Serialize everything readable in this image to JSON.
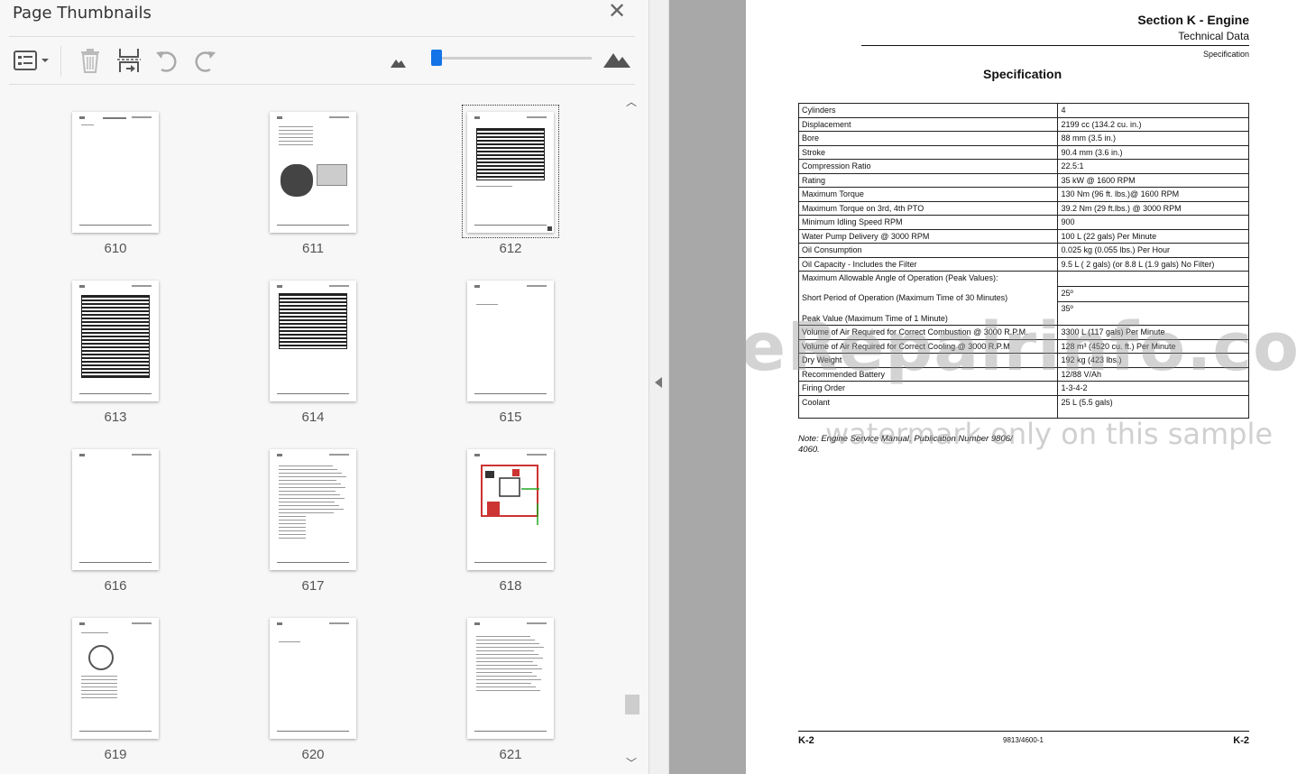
{
  "panel": {
    "title": "Page Thumbnails",
    "close_icon": "close-icon",
    "toolbar": {
      "options_icon": "thumbnail-options-icon",
      "delete_icon": "trash-icon",
      "extract_icon": "extract-pages-icon",
      "rotate_ccw_icon": "rotate-counterclockwise-icon",
      "rotate_cw_icon": "rotate-clockwise-icon",
      "zoom_out_icon": "mountain-small-icon",
      "zoom_in_icon": "mountain-large-icon",
      "zoom_level": 0.05
    },
    "thumbnails": [
      {
        "label": "610",
        "style": "blank-title"
      },
      {
        "label": "611",
        "style": "image-doc"
      },
      {
        "label": "612",
        "style": "table",
        "selected": true
      },
      {
        "label": "613",
        "style": "table-long"
      },
      {
        "label": "614",
        "style": "table-short"
      },
      {
        "label": "615",
        "style": "blank-mid"
      },
      {
        "label": "616",
        "style": "blank"
      },
      {
        "label": "617",
        "style": "text"
      },
      {
        "label": "618",
        "style": "diagram"
      },
      {
        "label": "619",
        "style": "gauge"
      },
      {
        "label": "620",
        "style": "blank-mid"
      },
      {
        "label": "621",
        "style": "text-links"
      }
    ]
  },
  "document": {
    "section_title": "Section K - Engine",
    "section_subtitle": "Technical Data",
    "section_small": "Specification",
    "heading": "Specification",
    "rows": [
      [
        "Cylinders",
        "4"
      ],
      [
        "Displacement",
        "2199 cc (134.2 cu. in.)"
      ],
      [
        "Bore",
        "88 mm (3.5 in.)"
      ],
      [
        "Stroke",
        "90.4 mm (3.6 in.)"
      ],
      [
        "Compression Ratio",
        "22.5:1"
      ],
      [
        "Rating",
        "35 kW @ 1600 RPM"
      ],
      [
        "Maximum Torque",
        "130 Nm (96 ft. lbs.)@ 1600 RPM"
      ],
      [
        "Maximum Torque on 3rd, 4th PTO",
        "39.2 Nm (29 ft.lbs.) @ 3000 RPM"
      ],
      [
        "Minimum Idling Speed RPM",
        "900"
      ],
      [
        "Water Pump Delivery @ 3000 RPM",
        "100 L (22 gals) Per Minute"
      ],
      [
        "Oil Consumption",
        "0.025 kg (0.055 lbs.) Per Hour"
      ],
      [
        "Oil Capacity - Includes the Filter",
        "9.5 L ( 2 gals) (or 8.8 L (1.9 gals) No Filter)"
      ]
    ],
    "angle_rows": {
      "label1": "Maximum Allowable Angle of Operation (Peak Values):",
      "label2": "Short Period of Operation (Maximum Time of 30 Minutes)",
      "label3": "Peak Value (Maximum Time of 1 Minute)",
      "value1": "",
      "value2": "25º",
      "value3": "35º"
    },
    "rows2": [
      [
        "Volume of Air Required for Correct Combustion @ 3000 R.P.M.",
        "3300 L (117 gals) Per Minute"
      ],
      [
        "Volume of Air Required for Correct Cooling @ 3000 R.P.M",
        "128 m³ (4520 cu. ft.) Per Minute"
      ],
      [
        "Dry Weight",
        "192 kg (423 lbs.)"
      ],
      [
        "Recommended Battery",
        "12/88 V/Ah"
      ],
      [
        "Firing Order",
        "1-3-4-2"
      ],
      [
        "Coolant",
        "25 L (5.5 gals)"
      ]
    ],
    "note": "Note: Engine Service Manual, Publication Number 9806/ 4060.",
    "watermark_main": "eRepairinfo.com",
    "watermark_sub": "watermark only on this sample",
    "footer_left": "K-2",
    "footer_center": "9813/4600-1",
    "footer_right": "K-2"
  }
}
